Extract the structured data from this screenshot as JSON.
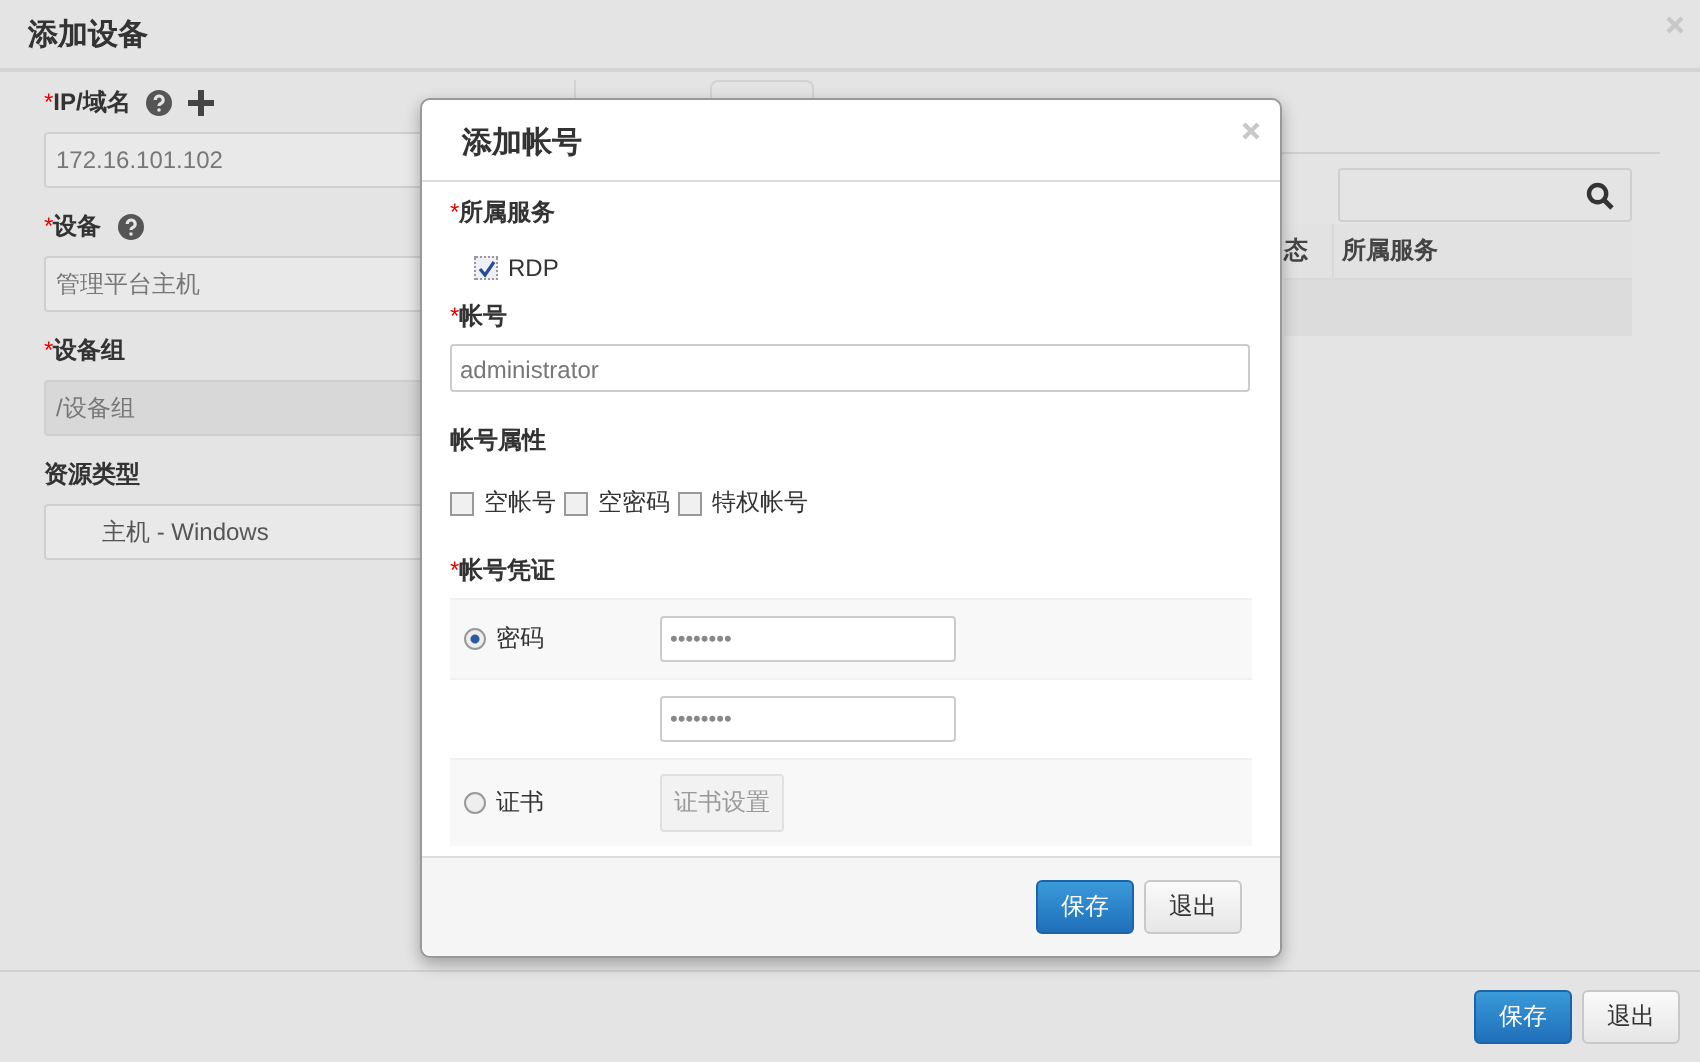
{
  "page": {
    "title": "添加设备"
  },
  "form": {
    "fields": [
      {
        "marker": "*",
        "label": "IP/域名",
        "help": true,
        "add": true,
        "value": "172.16.101.102",
        "disabled": false,
        "kind": "input"
      },
      {
        "marker": "*",
        "label": "设备",
        "help": true,
        "add": false,
        "value": "管理平台主机",
        "disabled": false,
        "kind": "input"
      },
      {
        "marker": "*",
        "label": "设备组",
        "help": false,
        "add": false,
        "value": "/设备组",
        "disabled": true,
        "kind": "input"
      },
      {
        "label": "资源类型",
        "help": false,
        "add": false,
        "value": "主机 - Windows",
        "disabled": false,
        "kind": "select"
      }
    ]
  },
  "table": {
    "columns": [
      "态",
      "所属服务"
    ]
  },
  "footer": {
    "buttons": [
      {
        "label": "保存",
        "kind": "primary"
      },
      {
        "label": "退出",
        "kind": "default"
      }
    ]
  },
  "dialog": {
    "title": "添加帐号",
    "service": {
      "marker": "*",
      "label": "所属服务",
      "options": [
        {
          "label": "RDP",
          "checked": true
        }
      ]
    },
    "account": {
      "marker": "*",
      "label": "帐号",
      "value": "administrator"
    },
    "attributes": {
      "label": "帐号属性",
      "options": [
        {
          "label": "空帐号",
          "checked": false
        },
        {
          "label": "空密码",
          "checked": false
        },
        {
          "label": "特权帐号",
          "checked": false
        }
      ]
    },
    "credential": {
      "marker": "*",
      "label": "帐号凭证",
      "choices": [
        {
          "label": "密码",
          "selected": true
        },
        {
          "label": "证书",
          "selected": false
        }
      ],
      "password": "••••••••",
      "confirm": "••••••••",
      "cert_button": {
        "label": "证书设置",
        "disabled": true
      }
    },
    "buttons": [
      {
        "label": "保存",
        "kind": "primary"
      },
      {
        "label": "退出",
        "kind": "default"
      }
    ]
  }
}
